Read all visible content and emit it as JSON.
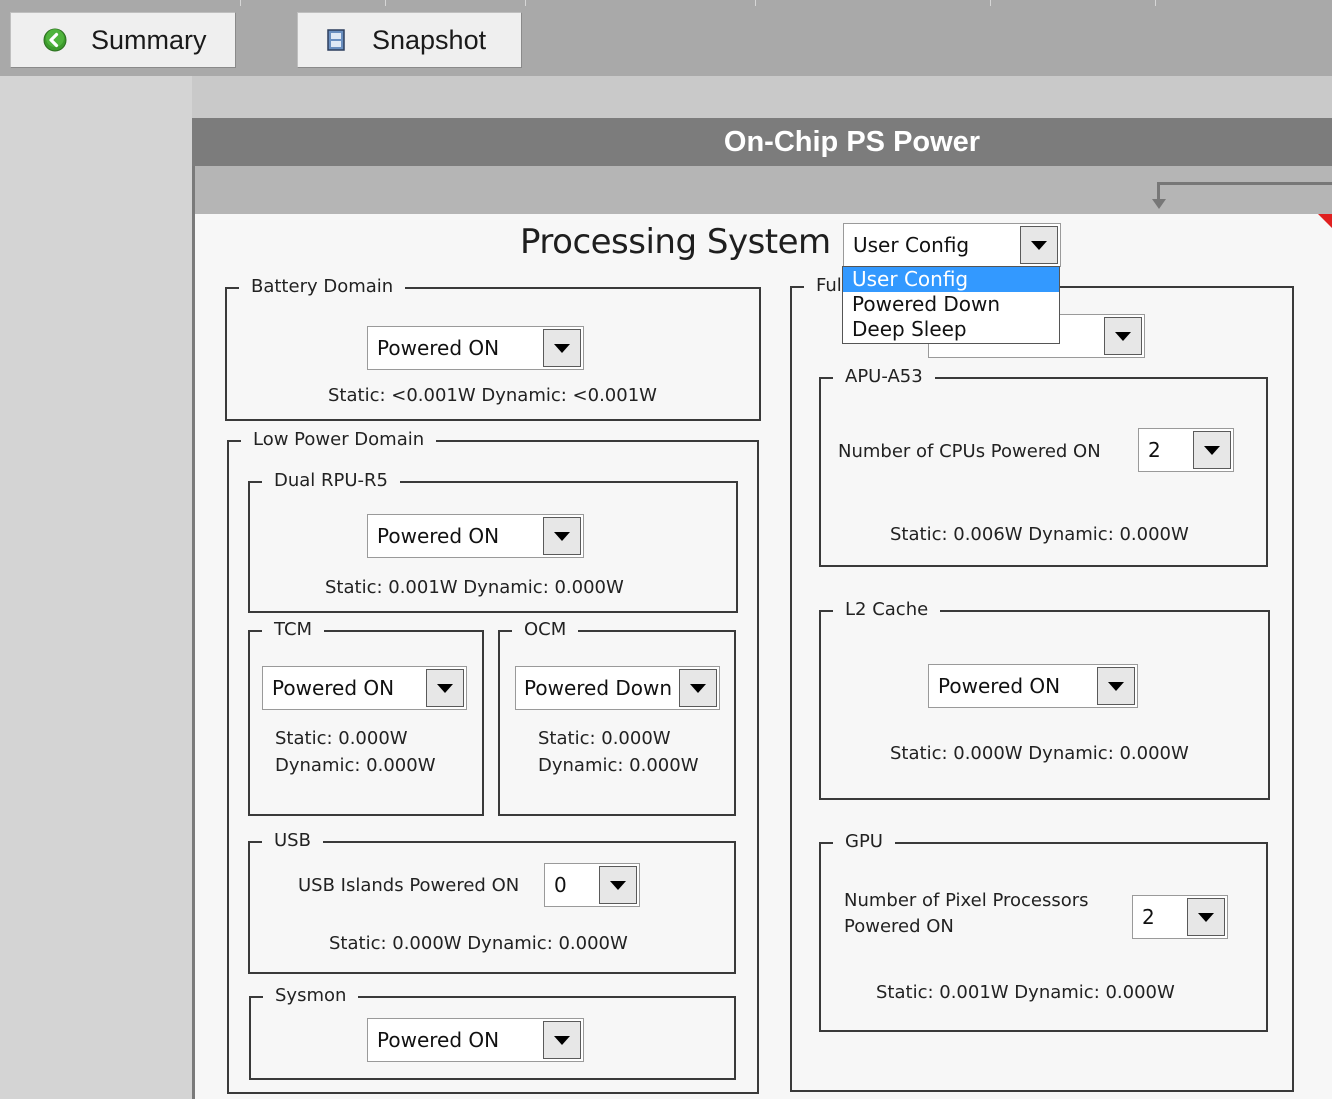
{
  "toolbar": {
    "summary_label": "Summary",
    "snapshot_label": "Snapshot"
  },
  "header": {
    "title": "On-Chip PS Power"
  },
  "processing_system": {
    "title": "Processing System",
    "mode_value": "User Config",
    "mode_options": [
      "User Config",
      "Powered Down",
      "Deep Sleep"
    ],
    "mode_selected_index": 0
  },
  "battery_domain": {
    "title": "Battery Domain",
    "power_value": "Powered ON",
    "stats": "Static: <0.001W   Dynamic: <0.001W"
  },
  "low_power_domain": {
    "title": "Low Power Domain",
    "dual_rpu": {
      "title": "Dual RPU-R5",
      "power_value": "Powered ON",
      "stats": "Static: 0.001W   Dynamic: 0.000W"
    },
    "tcm": {
      "title": "TCM",
      "power_value": "Powered ON",
      "static": "Static: 0.000W",
      "dynamic": "Dynamic: 0.000W"
    },
    "ocm": {
      "title": "OCM",
      "power_value": "Powered Down",
      "static": "Static: 0.000W",
      "dynamic": "Dynamic: 0.000W"
    },
    "usb": {
      "title": "USB",
      "islands_label": "USB Islands Powered ON",
      "islands_value": "0",
      "stats": "Static: 0.000W   Dynamic: 0.000W"
    },
    "sysmon": {
      "title": "Sysmon",
      "power_value": "Powered ON"
    }
  },
  "full_power_domain": {
    "title_visible": "Ful",
    "apu": {
      "title": "APU-A53",
      "cpus_label": "Number of CPUs Powered ON",
      "cpus_value": "2",
      "stats": "Static: 0.006W   Dynamic: 0.000W"
    },
    "l2_cache": {
      "title": "L2 Cache",
      "power_value": "Powered ON",
      "stats": "Static: 0.000W   Dynamic: 0.000W"
    },
    "gpu": {
      "title": "GPU",
      "pixel_label_line1": "Number of Pixel Processors",
      "pixel_label_line2": "Powered ON",
      "pixel_value": "2",
      "stats": "Static: 0.001W   Dynamic: 0.000W"
    }
  },
  "colors": {
    "header_bg": "#7c7c7c",
    "panel_bg": "#f7f7f7",
    "selection": "#3399ff",
    "alert_triangle": "#e02020"
  }
}
